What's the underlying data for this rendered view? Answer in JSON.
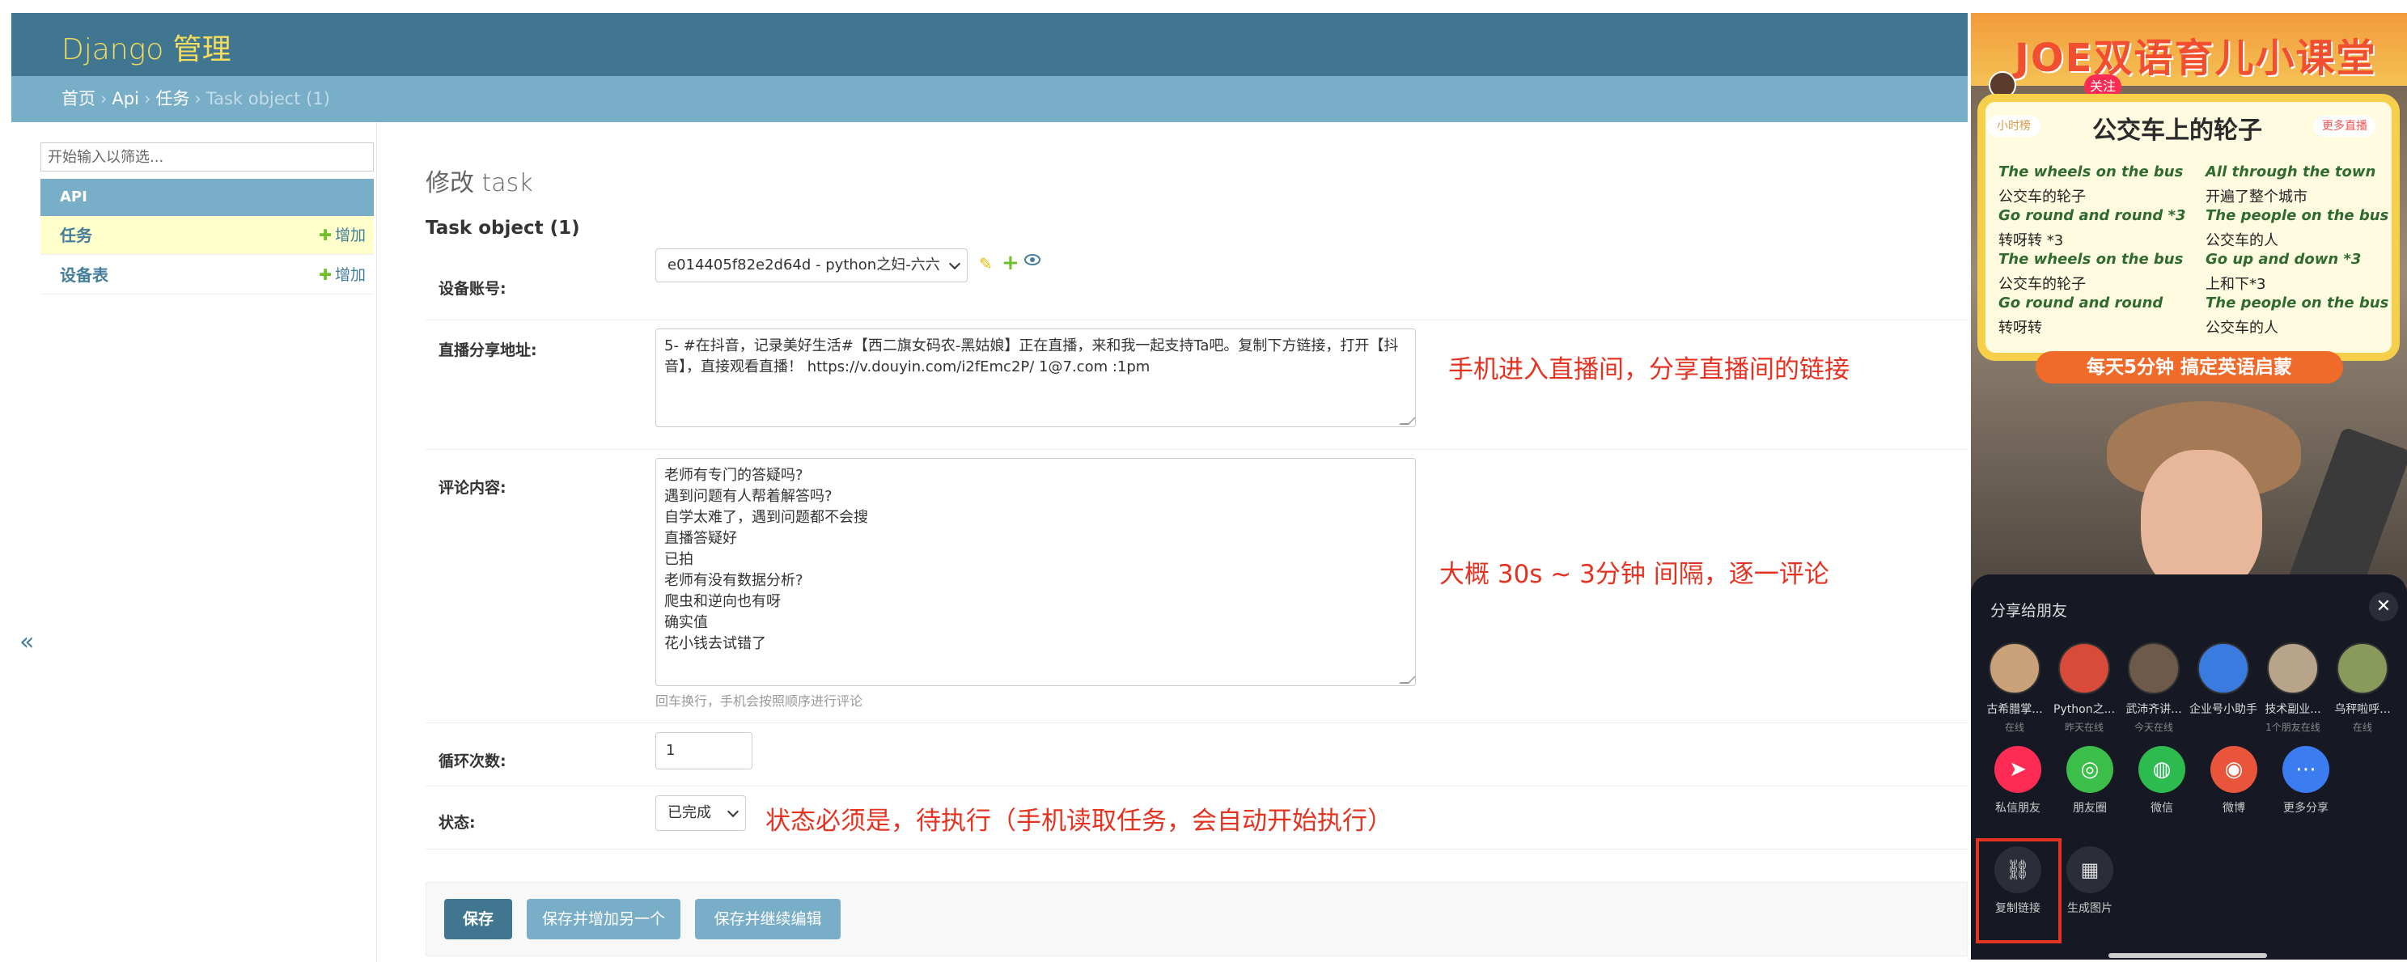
{
  "admin": {
    "branding": "Django 管理",
    "breadcrumbs": {
      "home": "首页",
      "app": "Api",
      "model": "任务",
      "current": "Task object (1)",
      "sep": "›"
    },
    "sidebar": {
      "filter_placeholder": "开始输入以筛选...",
      "app_caption": "API",
      "models": [
        {
          "name": "任务",
          "add_label": "增加",
          "selected": true
        },
        {
          "name": "设备表",
          "add_label": "增加",
          "selected": false
        }
      ],
      "collapse_glyph": "«"
    },
    "page_title": "修改 task",
    "object_title": "Task object (1)",
    "fields": {
      "device": {
        "label": "设备账号:",
        "value": "e014405f82e2d64d - python之妇-六六"
      },
      "share_url": {
        "label": "直播分享地址:",
        "value": "5- #在抖音，记录美好生活#【西二旗女码农-黑姑娘】正在直播，来和我一起支持Ta吧。复制下方链接，打开【抖音】，直接观看直播！ https://v.douyin.com/i2fEmc2P/ 1@7.com :1pm"
      },
      "comment": {
        "label": "评论内容:",
        "value": "老师有专门的答疑吗?\n遇到问题有人帮着解答吗?\n自学太难了，遇到问题都不会搜\n直播答疑好\n已拍\n老师有没有数据分析?\n爬虫和逆向也有呀\n确实值\n花小钱去试错了",
        "help": "回车换行，手机会按照顺序进行评论"
      },
      "loop": {
        "label": "循环次数:",
        "value": "1"
      },
      "status": {
        "label": "状态:",
        "value": "已完成"
      }
    },
    "buttons": {
      "save": "保存",
      "save_add": "保存并增加另一个",
      "save_continue": "保存并继续编辑"
    },
    "annotations": {
      "url_note": "手机进入直播间，分享直播间的链接",
      "interval_note": "大概 30s  ~ 3分钟  间隔，逐一评论",
      "status_note": "状态必须是，待执行（手机读取任务，会自动开始执行）"
    },
    "colors": {
      "header": "#417690",
      "breadcrumbs": "#79aec8",
      "branding": "#f5dd5d",
      "annotation": "#e53322"
    }
  },
  "phone": {
    "live_title": "JOE双语育儿小课堂",
    "follow_label": "关注",
    "board_title": "公交车上的轮子",
    "tag_left": "小时榜",
    "tag_right": "更多直播",
    "lyrics_left": [
      {
        "lang": "en",
        "text": "The wheels on the bus"
      },
      {
        "lang": "zh",
        "text": "公交车的轮子"
      },
      {
        "lang": "en",
        "text": "Go round and round *3"
      },
      {
        "lang": "zh",
        "text": "转呀转 *3"
      },
      {
        "lang": "en",
        "text": "The wheels on the bus"
      },
      {
        "lang": "zh",
        "text": "公交车的轮子"
      },
      {
        "lang": "en",
        "text": "Go round and round"
      },
      {
        "lang": "zh",
        "text": "转呀转"
      }
    ],
    "lyrics_right": [
      {
        "lang": "en",
        "text": "All through the town"
      },
      {
        "lang": "zh",
        "text": "开遍了整个城市"
      },
      {
        "lang": "en",
        "text": "The people on the bus"
      },
      {
        "lang": "zh",
        "text": "公交车的人"
      },
      {
        "lang": "en",
        "text": "Go up and down *3"
      },
      {
        "lang": "zh",
        "text": "上和下*3"
      },
      {
        "lang": "en",
        "text": "The people on the bus"
      },
      {
        "lang": "zh",
        "text": "公交车的人"
      }
    ],
    "ribbon": "每天5分钟  搞定英语启蒙",
    "share_sheet": {
      "title": "分享给朋友",
      "close_glyph": "✕",
      "friends": [
        {
          "name": "古希腊掌...",
          "status": "在线",
          "color": "#c9a27a"
        },
        {
          "name": "Python之...",
          "status": "昨天在线",
          "color": "#d84a3a"
        },
        {
          "name": "武沛齐讲...",
          "status": "今天在线",
          "color": "#6d5a4a"
        },
        {
          "name": "企业号小助手",
          "status": "",
          "color": "#3a7be0"
        },
        {
          "name": "技术副业...",
          "status": "1个朋友在线",
          "color": "#b8a48a"
        },
        {
          "name": "乌秤啦呼...",
          "status": "在线",
          "color": "#8a9a5a"
        }
      ],
      "apps": [
        {
          "label": "私信朋友",
          "glyph": "➤",
          "color": "#fe2c55"
        },
        {
          "label": "朋友圈",
          "glyph": "◎",
          "color": "#3cbf4a"
        },
        {
          "label": "微信",
          "glyph": "◍",
          "color": "#2dbb4f"
        },
        {
          "label": "微博",
          "glyph": "◉",
          "color": "#e8553a"
        },
        {
          "label": "更多分享",
          "glyph": "⋯",
          "color": "#3b7cf0"
        }
      ],
      "tools": [
        {
          "label": "复制链接",
          "glyph": "⛓"
        },
        {
          "label": "生成图片",
          "glyph": "▦"
        }
      ]
    }
  }
}
